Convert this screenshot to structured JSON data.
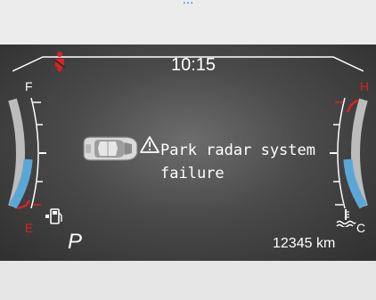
{
  "top_caption": "...",
  "cluster": {
    "clock": "10:15",
    "fuel_gauge": {
      "full_label": "F",
      "empty_label": "E"
    },
    "temp_gauge": {
      "hot_label": "H",
      "cold_label": "C"
    },
    "gear": "P",
    "odometer": "12345 km",
    "warning": {
      "message": "Park radar system\nfailure"
    },
    "colors": {
      "accent_blue": "#5aa7d6",
      "alert_red": "#e02020",
      "text_white": "#ffffff"
    }
  }
}
